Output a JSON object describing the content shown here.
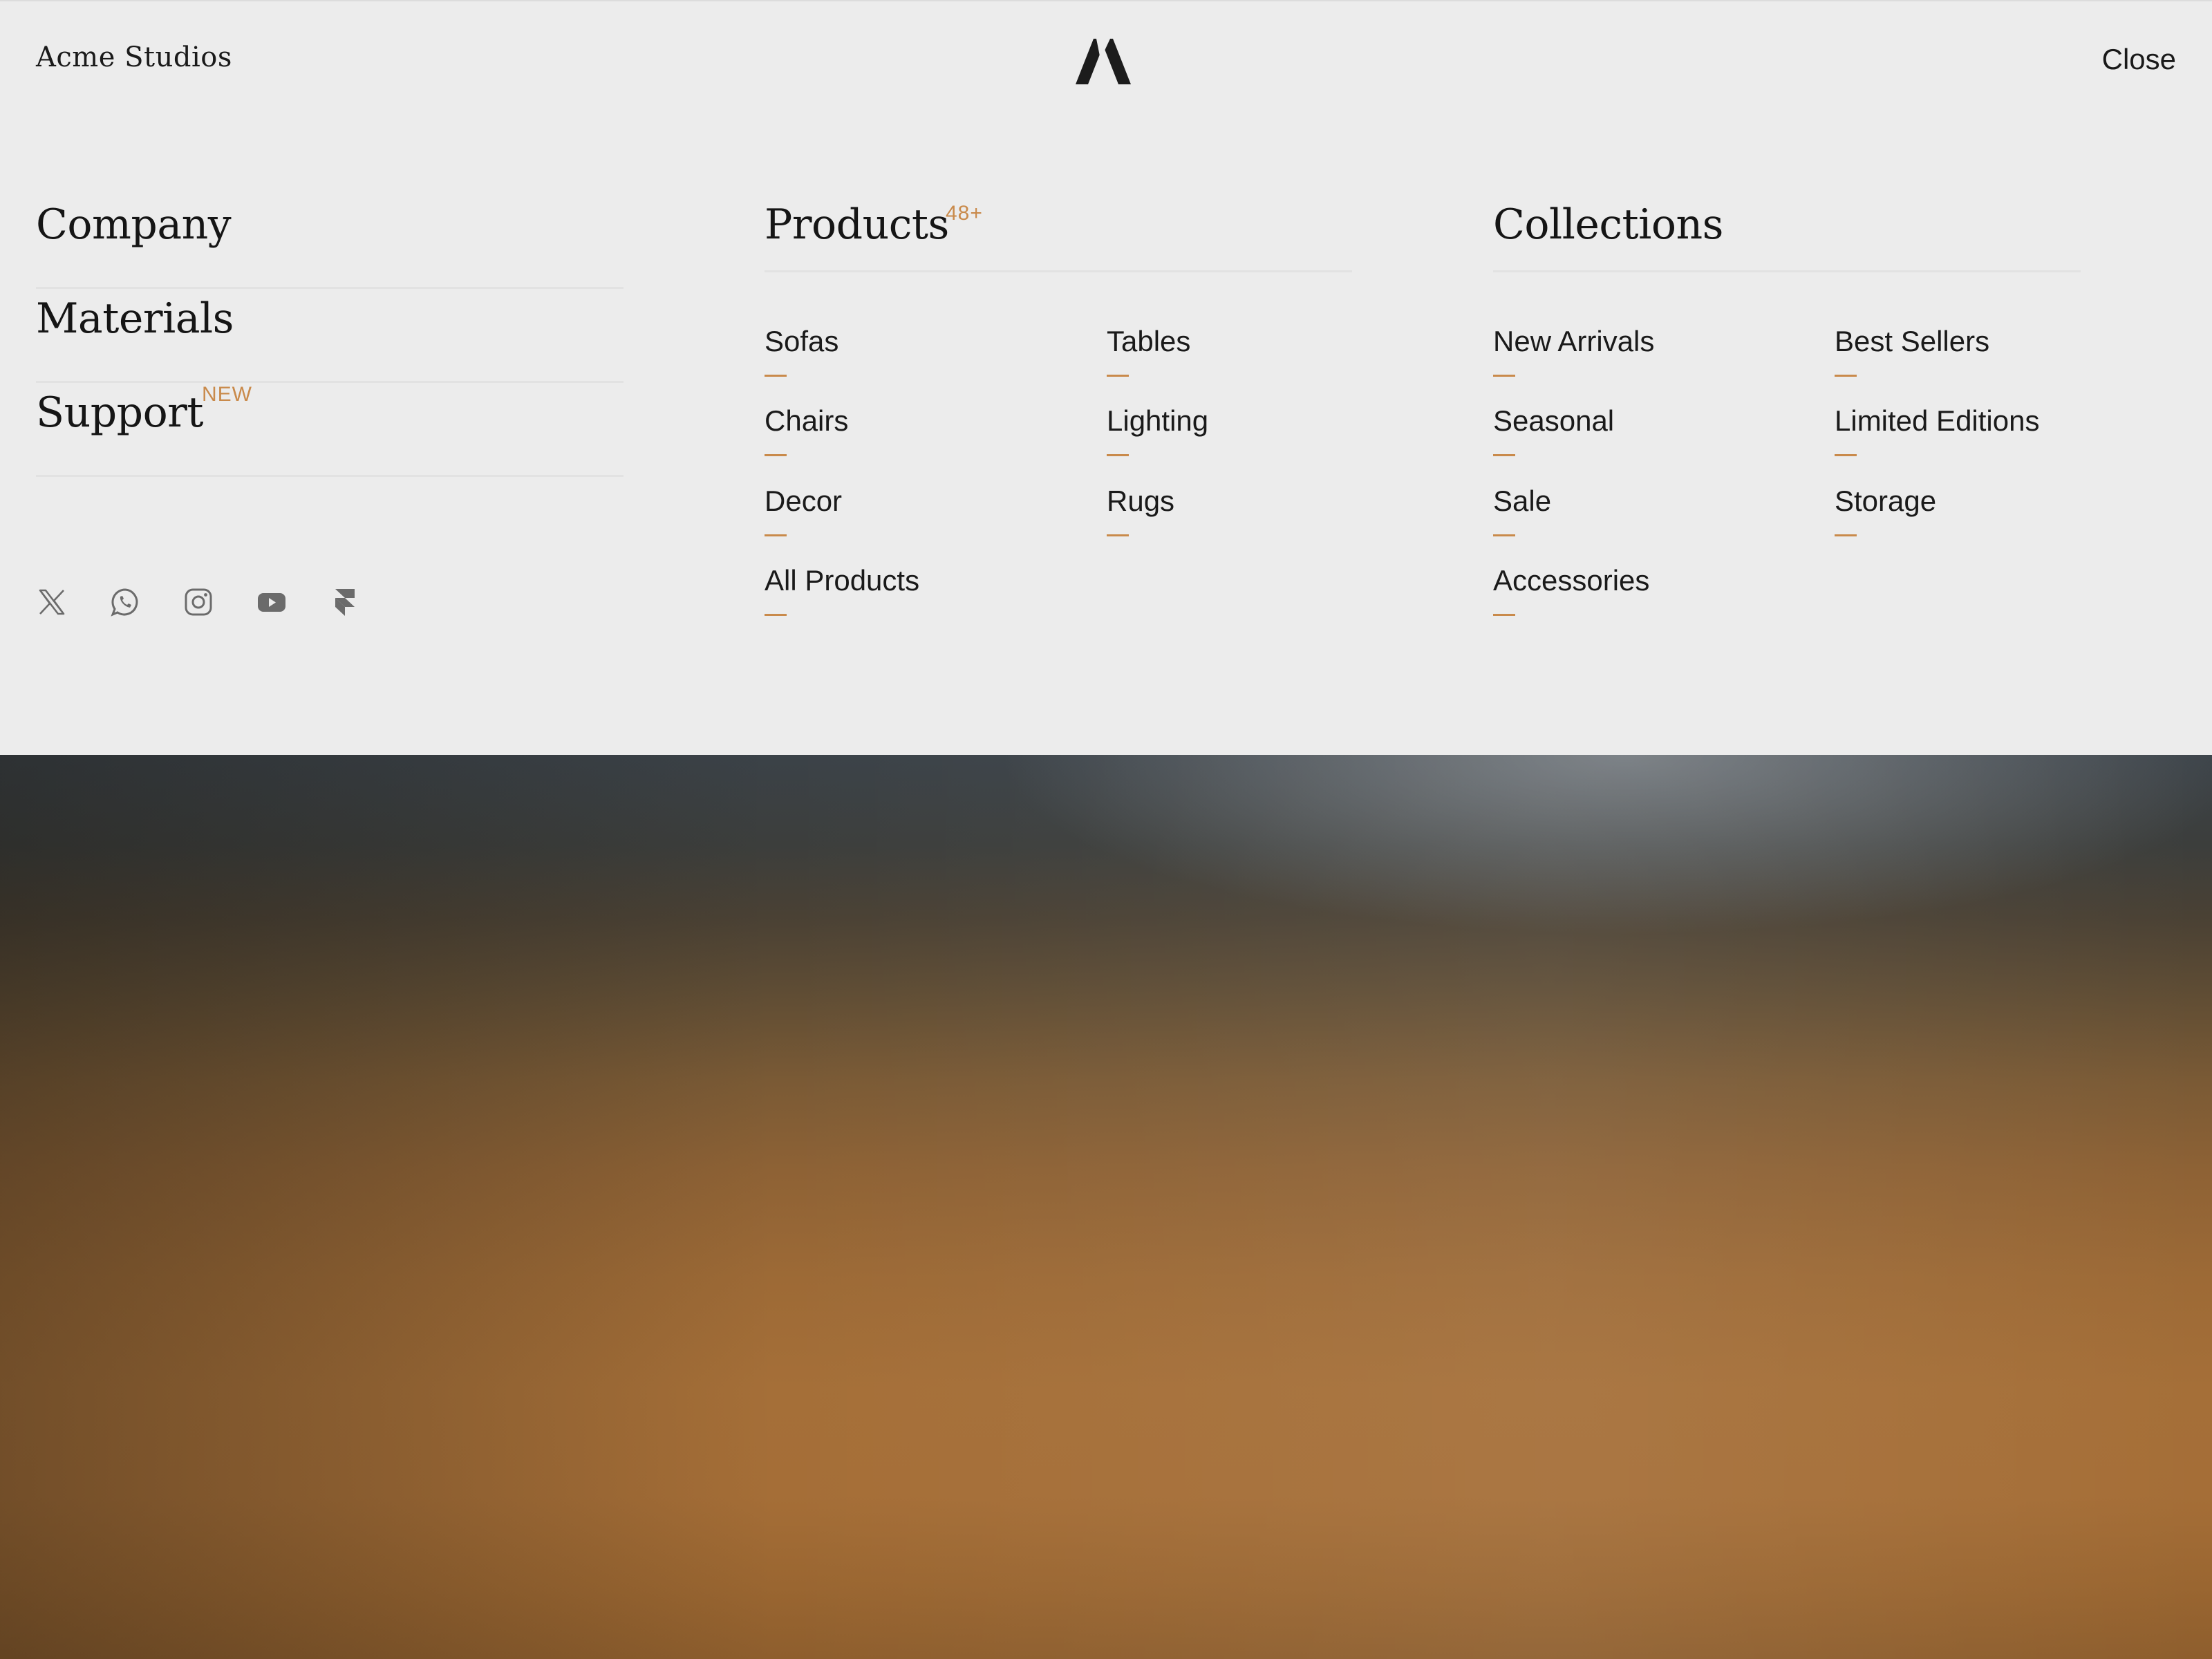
{
  "header": {
    "brand": "Acme Studios",
    "logo_icon": "acme-a-logo-icon",
    "close_label": "Close"
  },
  "primary_nav": [
    {
      "label": "Company",
      "badge": ""
    },
    {
      "label": "Materials",
      "badge": ""
    },
    {
      "label": "Support",
      "badge": "NEW"
    }
  ],
  "products": {
    "title": "Products",
    "count": "48+",
    "links": [
      "Sofas",
      "Tables",
      "Chairs",
      "Lighting",
      "Decor",
      "Rugs",
      "All Products"
    ]
  },
  "collections": {
    "title": "Collections",
    "links": [
      "New Arrivals",
      "Best Sellers",
      "Seasonal",
      "Limited Editions",
      "Sale",
      "Storage",
      "Accessories"
    ]
  },
  "socials": [
    {
      "icon": "x-twitter-icon"
    },
    {
      "icon": "whatsapp-icon"
    },
    {
      "icon": "instagram-icon"
    },
    {
      "icon": "youtube-icon"
    },
    {
      "icon": "framer-icon"
    }
  ],
  "colors": {
    "panel_bg": "#ececec",
    "accent": "#c98a4b",
    "text": "#1a1a1a",
    "icon_gray": "#6b6b6b"
  }
}
